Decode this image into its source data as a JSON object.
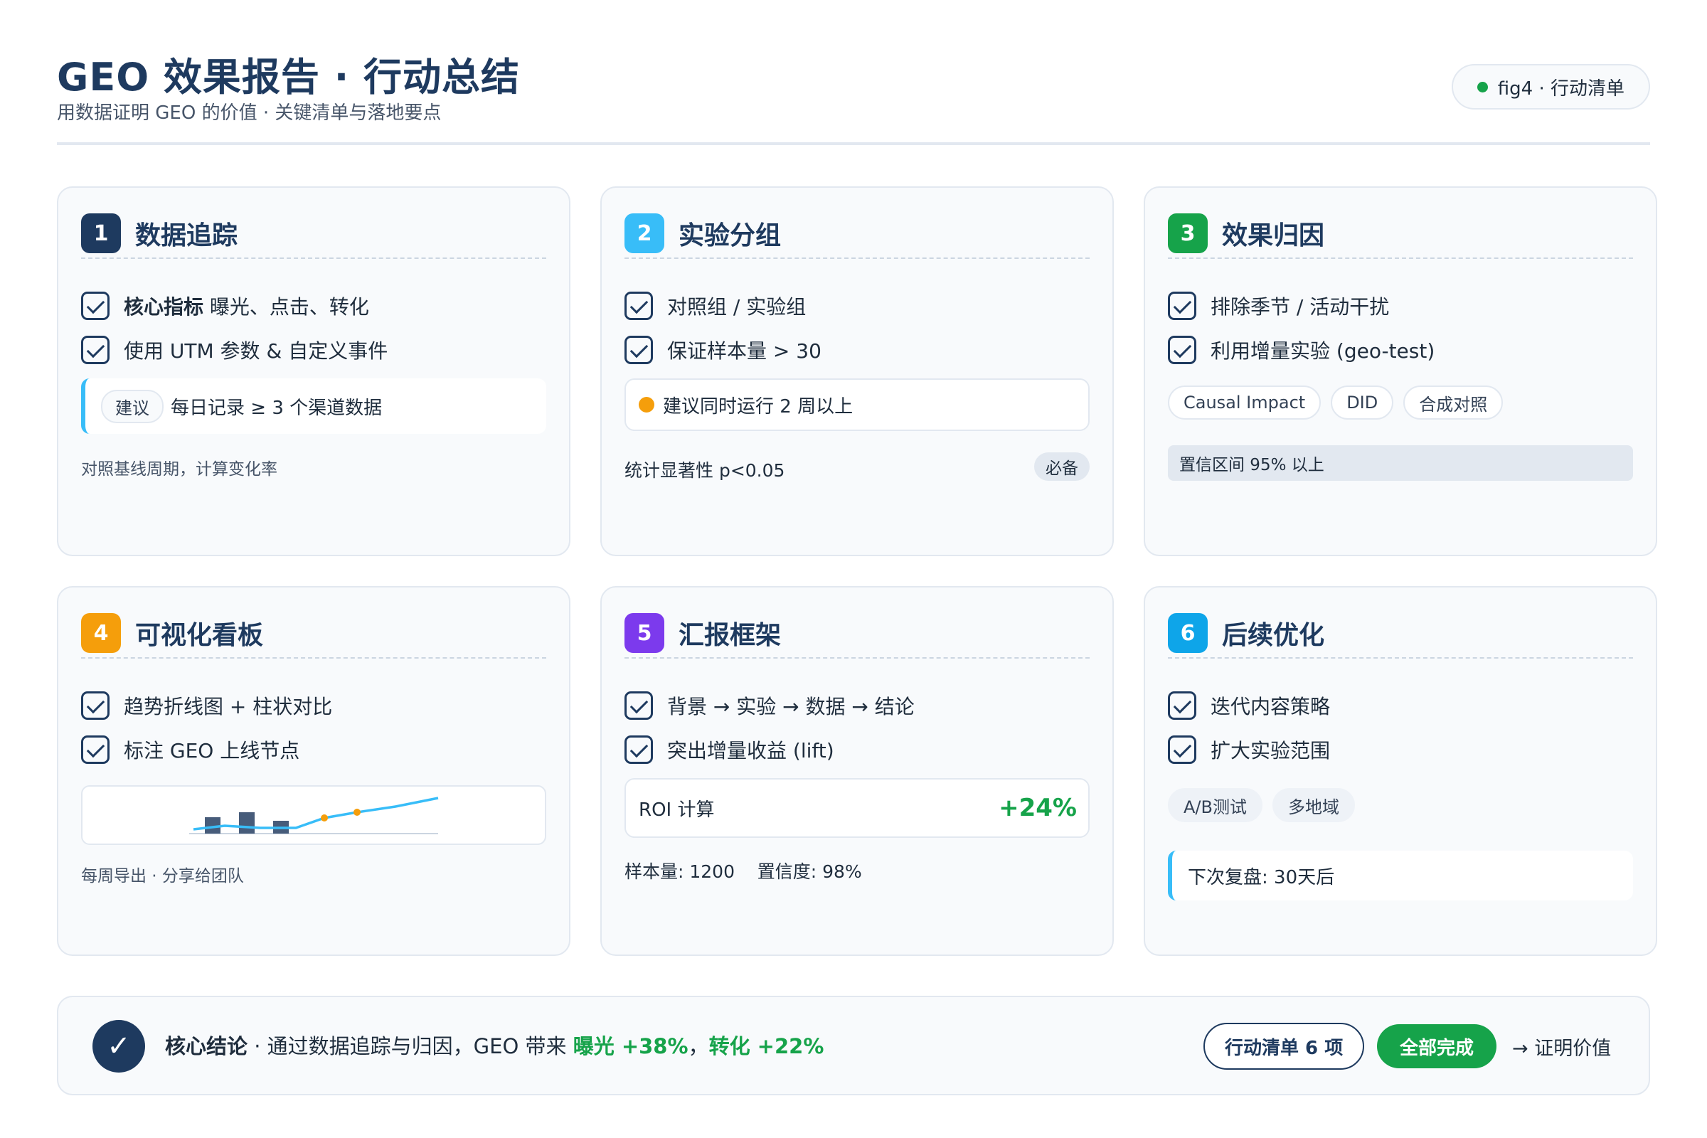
{
  "header": {
    "title": "GEO 效果报告 · 行动总结",
    "subtitle": "用数据证明 GEO 的价值 · 关键清单与落地要点",
    "badge": "fig4 · 行动清单",
    "badge_dot_color": "#16a34a"
  },
  "colors": {
    "navy": "#1e3a5f",
    "sky": "#38bdf8",
    "green": "#16a34a",
    "orange": "#f59e0b",
    "purple": "#7c3aed",
    "blue": "#0ea5e9"
  },
  "cards": [
    {
      "num": "1",
      "title": "数据追踪",
      "items": [
        {
          "strong": "核心指标",
          "text": " 曝光、点击、转化"
        },
        {
          "text": "使用 UTM 参数 & 自定义事件"
        }
      ],
      "tip_tag": "建议",
      "tip_text": "每日记录 ≥ 3 个渠道数据",
      "note": "对照基线周期，计算变化率"
    },
    {
      "num": "2",
      "title": "实验分组",
      "items": [
        {
          "text": "对照组 / 实验组"
        },
        {
          "text": "保证样本量 > 30"
        }
      ],
      "warn_text": "建议同时运行 2 周以上",
      "note": "统计显著性 p<0.05",
      "badge": "必备"
    },
    {
      "num": "3",
      "title": "效果归因",
      "items": [
        {
          "text": "排除季节 / 活动干扰"
        },
        {
          "text": "利用增量实验 (geo-test)"
        }
      ],
      "chips": [
        "Causal Impact",
        "DID",
        "合成对照"
      ],
      "bar_text": "置信区间 95% 以上"
    },
    {
      "num": "4",
      "title": "可视化看板",
      "items": [
        {
          "text": "趋势折线图 + 柱状对比"
        },
        {
          "text": "标注 GEO 上线节点"
        }
      ],
      "note": "每周导出 · 分享给团队"
    },
    {
      "num": "5",
      "title": "汇报框架",
      "items": [
        {
          "text": "背景 → 实验 → 数据 → 结论"
        },
        {
          "text": "突出增量收益 (lift)"
        }
      ],
      "roi_label": "ROI 计算",
      "roi_value": "+24%",
      "note": "样本量: 1200    置信度: 98%"
    },
    {
      "num": "6",
      "title": "后续优化",
      "items": [
        {
          "text": "迭代内容策略"
        },
        {
          "text": "扩大实验范围"
        }
      ],
      "chips": [
        "A/B测试",
        "多地域"
      ],
      "tip_text": "下次复盘: 30天后"
    }
  ],
  "footer": {
    "label": "核心结论",
    "sep": " · ",
    "text": "通过数据追踪与归因，GEO 带来 ",
    "metric1": "曝光 +38%",
    "comma": "，",
    "metric2": "转化 +22%",
    "btn_outline": "行动清单 6 项",
    "btn_green": "全部完成",
    "link": "→ 证明价值"
  }
}
